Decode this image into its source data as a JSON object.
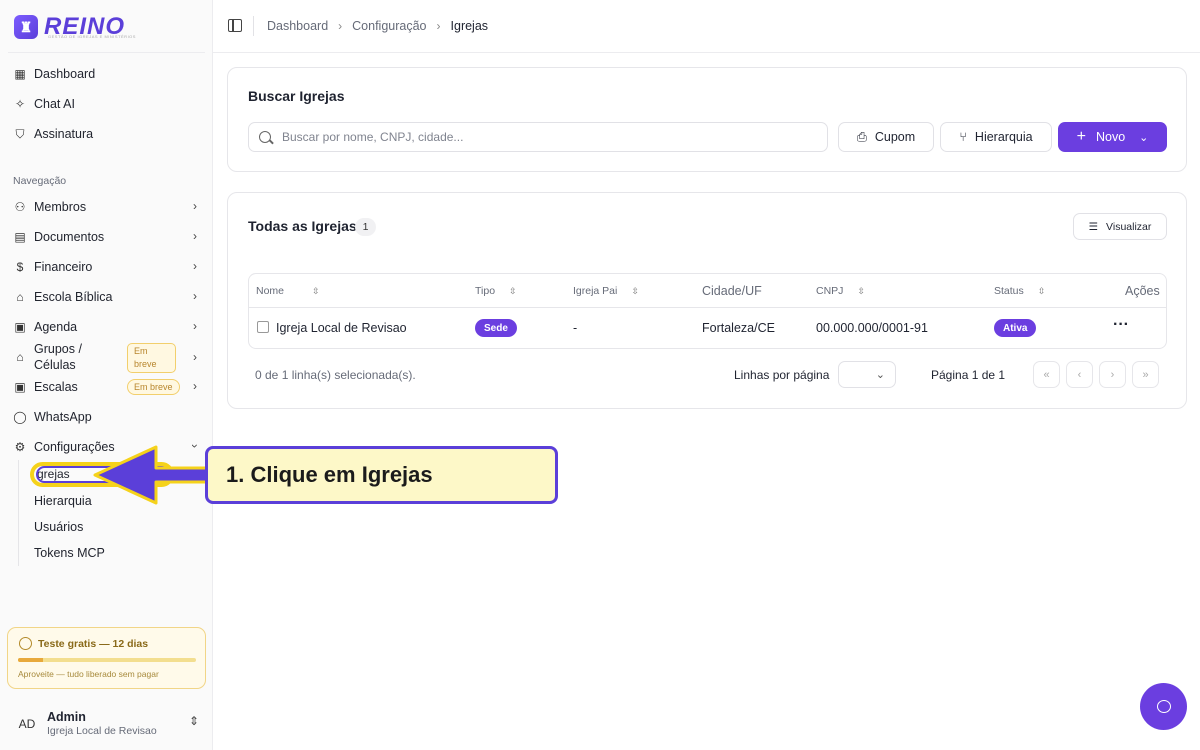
{
  "brand": {
    "name": "REINO",
    "tagline": "GESTÃO DE IGREJAS E MINISTÉRIOS"
  },
  "sidebar": {
    "top_items": [
      {
        "label": "Dashboard",
        "icon": "grid-icon"
      },
      {
        "label": "Chat AI",
        "icon": "sparkles-icon"
      },
      {
        "label": "Assinatura",
        "icon": "shield-icon"
      }
    ],
    "section_label": "Navegação",
    "nav_items": [
      {
        "label": "Membros",
        "icon": "users-icon"
      },
      {
        "label": "Documentos",
        "icon": "document-icon"
      },
      {
        "label": "Financeiro",
        "icon": "dollar-icon"
      },
      {
        "label": "Escola Bíblica",
        "icon": "graduation-cap-icon"
      },
      {
        "label": "Agenda",
        "icon": "calendar-icon"
      },
      {
        "label": "Grupos / Células",
        "icon": "home-icon",
        "badge": "Em breve"
      },
      {
        "label": "Escalas",
        "icon": "calendar-icon",
        "badge": "Em breve"
      },
      {
        "label": "WhatsApp",
        "icon": "chat-bubble-icon"
      },
      {
        "label": "Configurações",
        "icon": "gear-icon"
      }
    ],
    "grupos_line1": "Grupos /",
    "grupos_line2": "Células",
    "badge_soon_line1": "Em",
    "badge_soon_line2": "breve",
    "config_sub_items": [
      "grejas",
      "Hierarquia",
      "Usuários",
      "Tokens MCP"
    ]
  },
  "trial": {
    "title": "Teste gratis — 12 dias",
    "subtitle": "Aproveite — tudo liberado sem pagar",
    "progress": 0.14
  },
  "user": {
    "initials": "AD",
    "name": "Admin",
    "org": "Igreja Local de Revisao"
  },
  "breadcrumb": [
    "Dashboard",
    "Configuração",
    "Igrejas"
  ],
  "search_card": {
    "title": "Buscar Igrejas",
    "placeholder": "Buscar por nome, CNPJ, cidade...",
    "btn_cupom": "Cupom",
    "btn_hierarquia": "Hierarquia",
    "btn_novo": "Novo"
  },
  "table_card": {
    "title": "Todas as Igrejas",
    "count": "1",
    "visualizar": "Visualizar",
    "columns": [
      "Nome",
      "Tipo",
      "Igreja Pai",
      "Cidade/UF",
      "CNPJ",
      "Status",
      "Ações"
    ],
    "rows": [
      {
        "nome": "Igreja Local de Revisao",
        "tipo": "Sede",
        "pai": "-",
        "cidade": "Fortaleza/CE",
        "cnpj": "00.000.000/0001-91",
        "status": "Ativa",
        "acoes": "···"
      }
    ],
    "selected_text": "0 de 1 linha(s) selecionada(s).",
    "rows_per_page_label": "Linhas por página",
    "page_text": "Página 1 de 1"
  },
  "annotation": {
    "text": "1. Clique em Igrejas"
  },
  "colors": {
    "accent": "#6b3ee0",
    "highlight": "#f5d21b",
    "callout_bg": "#fdf8c8"
  }
}
